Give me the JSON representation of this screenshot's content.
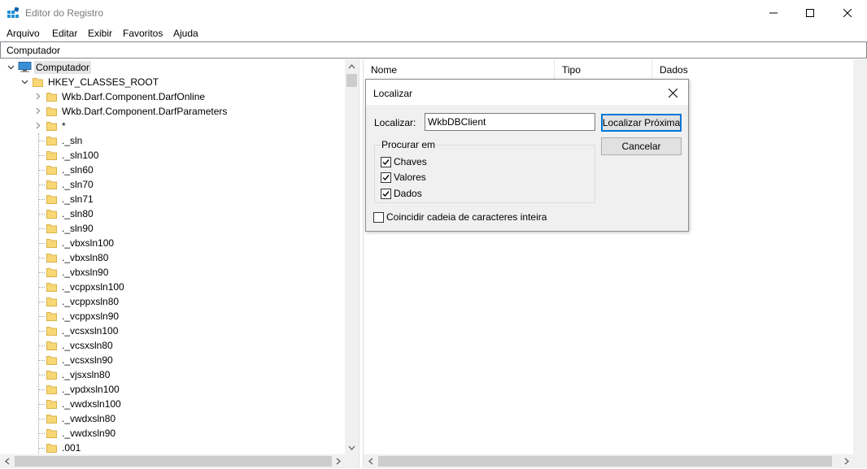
{
  "window": {
    "title": "Editor do Registro"
  },
  "menu": [
    "Arquivo",
    "Editar",
    "Exibir",
    "Favoritos",
    "Ajuda"
  ],
  "address": "Computador",
  "tree": {
    "root": "Computador",
    "hive": "HKEY_CLASSES_ROOT",
    "items": [
      {
        "label": "Wkb.Darf.Component.DarfOnline",
        "expandable": true
      },
      {
        "label": "Wkb.Darf.Component.DarfParameters",
        "expandable": true
      },
      {
        "label": "*",
        "expandable": true
      },
      {
        "label": "._sln",
        "expandable": false
      },
      {
        "label": "._sln100",
        "expandable": false
      },
      {
        "label": "._sln60",
        "expandable": false
      },
      {
        "label": "._sln70",
        "expandable": false
      },
      {
        "label": "._sln71",
        "expandable": false
      },
      {
        "label": "._sln80",
        "expandable": false
      },
      {
        "label": "._sln90",
        "expandable": false
      },
      {
        "label": "._vbxsln100",
        "expandable": false
      },
      {
        "label": "._vbxsln80",
        "expandable": false
      },
      {
        "label": "._vbxsln90",
        "expandable": false
      },
      {
        "label": "._vcppxsln100",
        "expandable": false
      },
      {
        "label": "._vcppxsln80",
        "expandable": false
      },
      {
        "label": "._vcppxsln90",
        "expandable": false
      },
      {
        "label": "._vcsxsln100",
        "expandable": false
      },
      {
        "label": "._vcsxsln80",
        "expandable": false
      },
      {
        "label": "._vcsxsln90",
        "expandable": false
      },
      {
        "label": "._vjsxsln80",
        "expandable": false
      },
      {
        "label": "._vpdxsln100",
        "expandable": false
      },
      {
        "label": "._vwdxsln100",
        "expandable": false
      },
      {
        "label": "._vwdxsln80",
        "expandable": false
      },
      {
        "label": "._vwdxsln90",
        "expandable": false
      },
      {
        "label": ".001",
        "expandable": false
      }
    ]
  },
  "list": {
    "columns": [
      "Nome",
      "Tipo",
      "Dados"
    ]
  },
  "dialog": {
    "title": "Localizar",
    "find_label": "Localizar:",
    "find_value": "WkbDBClient",
    "find_next_button": "Localizar Próxima",
    "cancel_button": "Cancelar",
    "group_title": "Procurar em",
    "options": [
      {
        "label": "Chaves",
        "checked": true
      },
      {
        "label": "Valores",
        "checked": true
      },
      {
        "label": "Dados",
        "checked": true
      }
    ],
    "match_whole": {
      "label": "Coincidir cadeia de caracteres inteira",
      "checked": false
    }
  },
  "colors": {
    "folder": "#f8d775",
    "folder_edge": "#d9b24a",
    "accent": "#0078d7"
  }
}
